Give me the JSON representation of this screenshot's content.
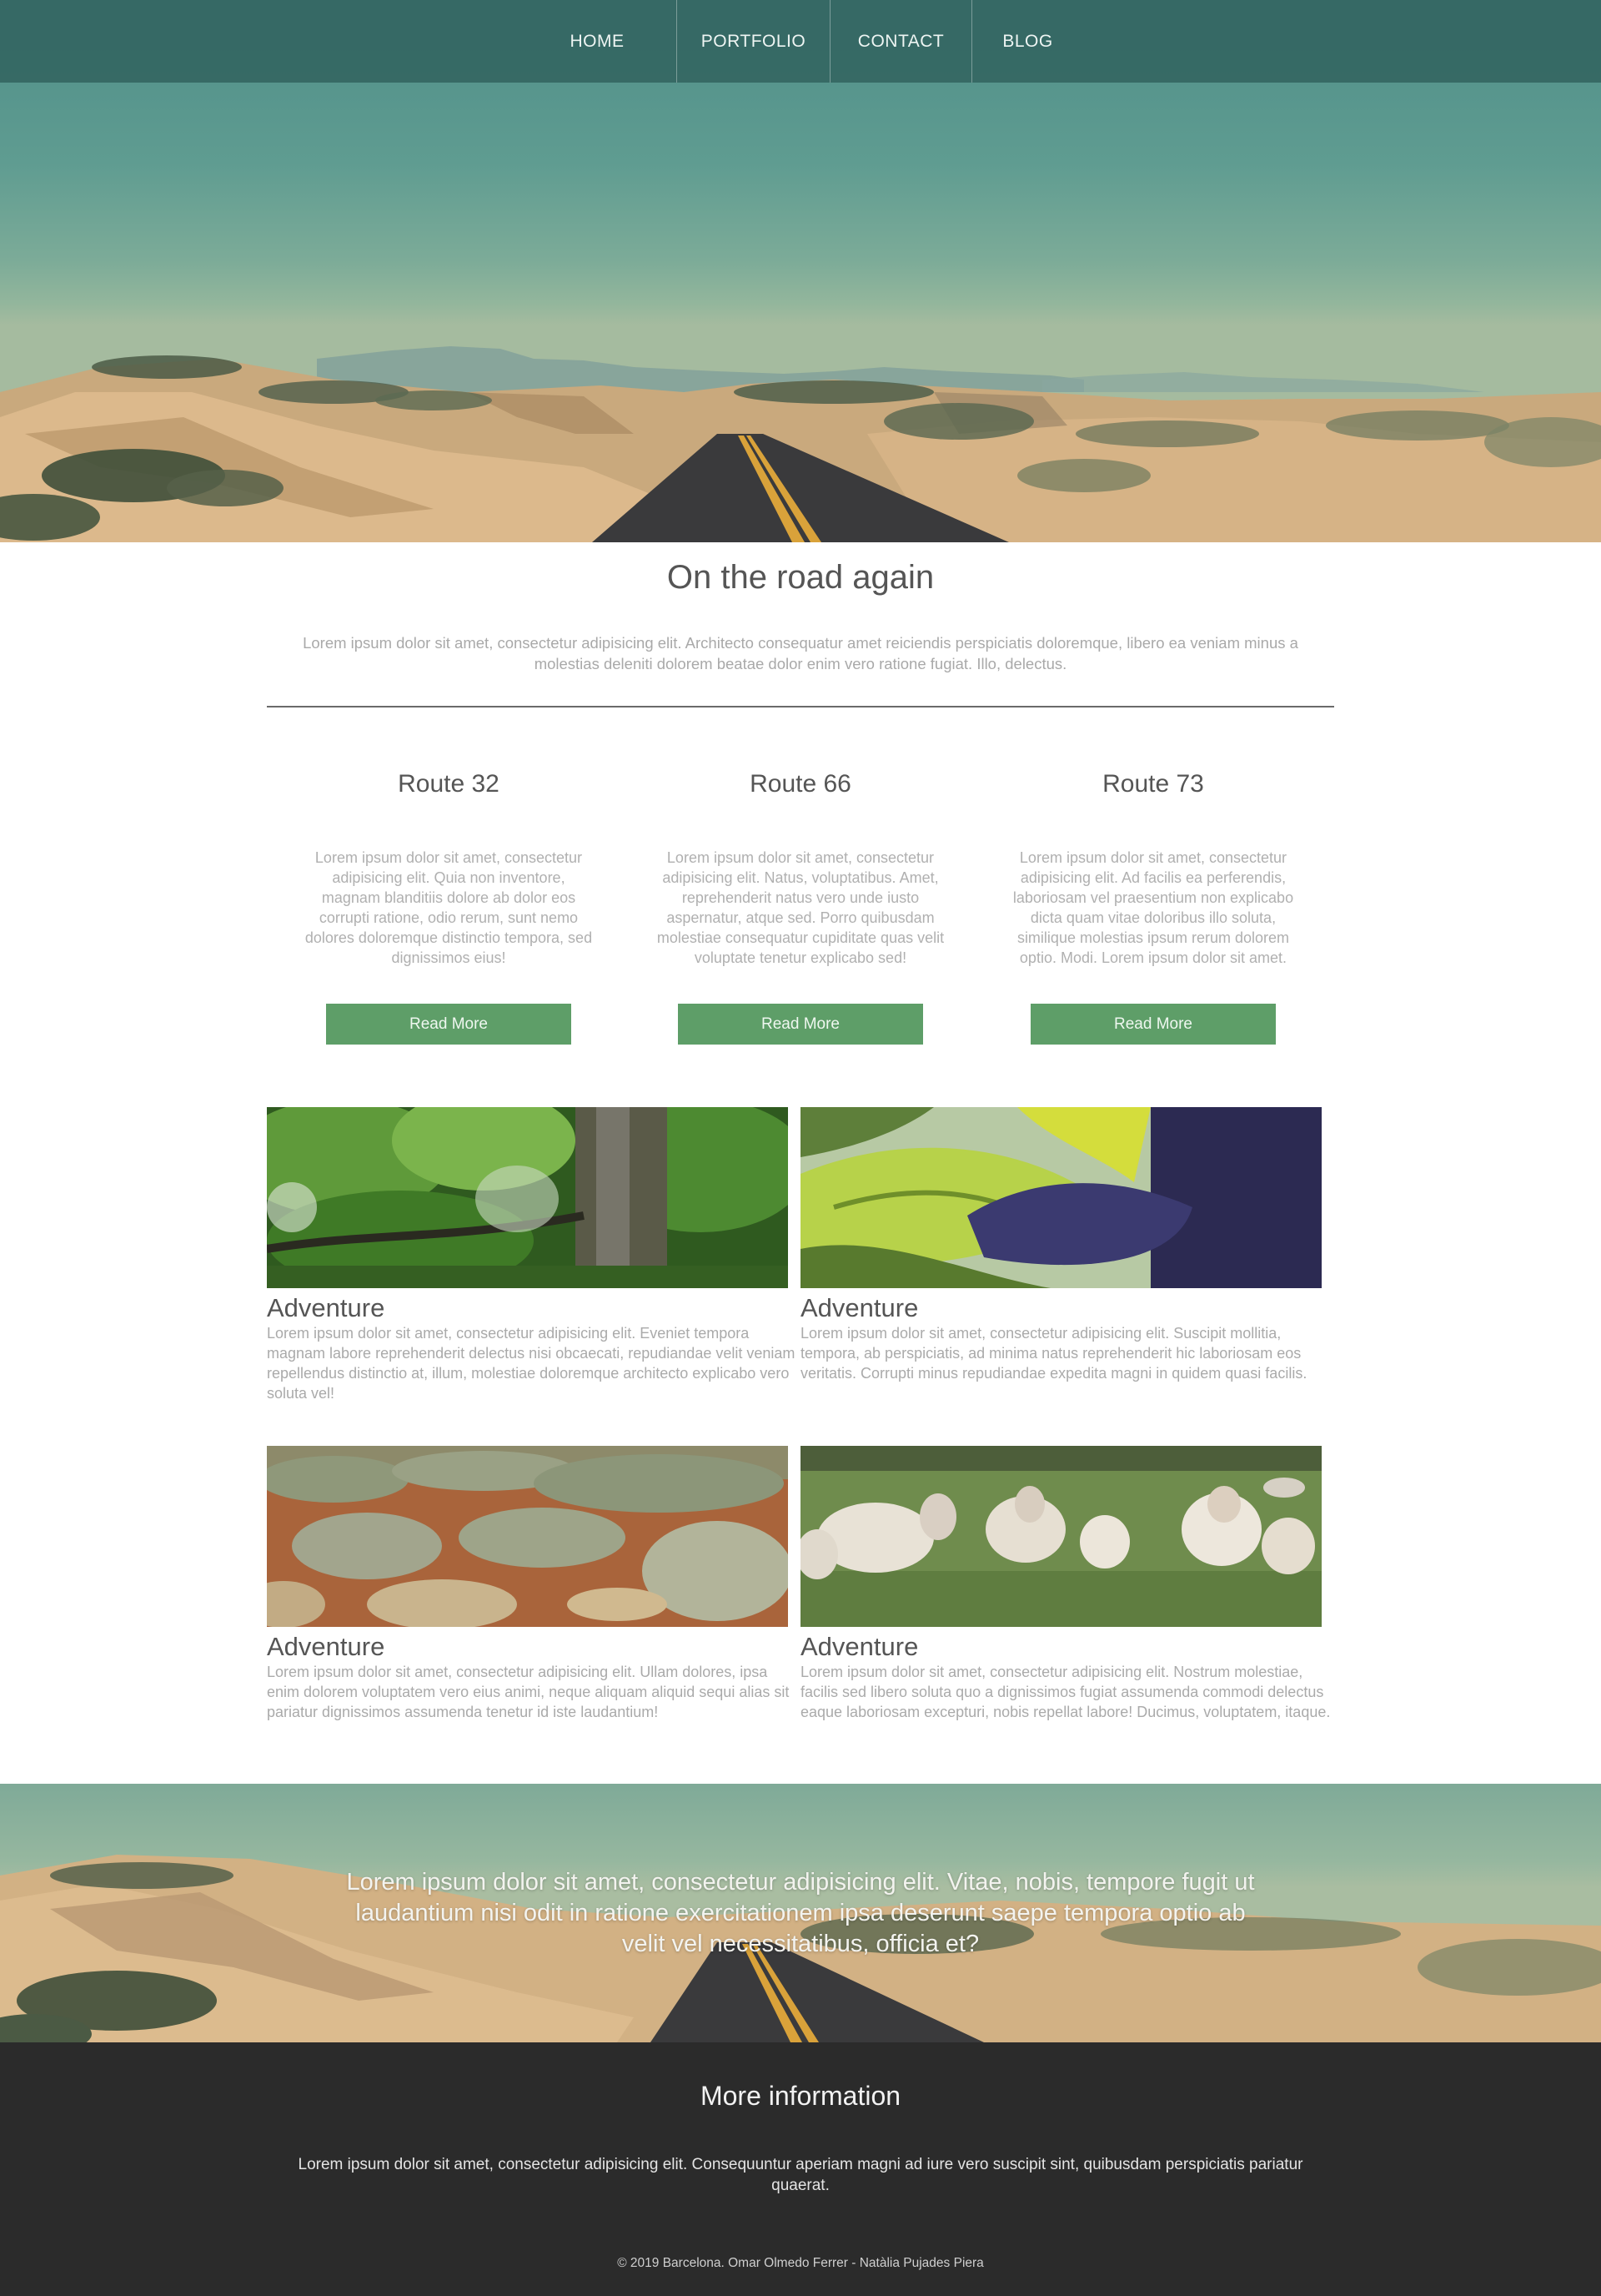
{
  "nav": {
    "items": [
      {
        "label": "HOME"
      },
      {
        "label": "PORTFOLIO"
      },
      {
        "label": "CONTACT"
      },
      {
        "label": "BLOG"
      }
    ]
  },
  "intro": {
    "title": "On the road again",
    "text": "Lorem ipsum dolor sit amet, consectetur adipisicing elit. Architecto consequatur amet reiciendis perspiciatis doloremque, libero ea veniam minus a molestias deleniti dolorem beatae dolor enim vero ratione fugiat. Illo, delectus."
  },
  "routes": [
    {
      "title": "Route 32",
      "text": "Lorem ipsum dolor sit amet, consectetur adipisicing elit. Quia non inventore, magnam blanditiis dolore ab dolor eos corrupti ratione, odio rerum, sunt nemo dolores doloremque distinctio tempora, sed dignissimos eius!",
      "button": "Read More"
    },
    {
      "title": "Route 66",
      "text": "Lorem ipsum dolor sit amet, consectetur adipisicing elit. Natus, voluptatibus. Amet, reprehenderit natus vero unde iusto aspernatur, atque sed. Porro quibusdam molestiae consequatur cupiditate quas velit voluptate tenetur explicabo sed!",
      "button": "Read More"
    },
    {
      "title": "Route 73",
      "text": "Lorem ipsum dolor sit amet, consectetur adipisicing elit. Ad facilis ea perferendis, laboriosam vel praesentium non explicabo dicta quam vitae doloribus illo soluta, similique molestias ipsum rerum dolorem optio. Modi. Lorem ipsum dolor sit amet.",
      "button": "Read More"
    }
  ],
  "gallery": [
    {
      "title": "Adventure",
      "text": "Lorem ipsum dolor sit amet, consectetur adipisicing elit. Eveniet tempora magnam labore reprehenderit delectus nisi obcaecati, repudiandae velit veniam repellendus distinctio at, illum, molestiae doloremque architecto explicabo vero soluta vel!"
    },
    {
      "title": "Adventure",
      "text": "Lorem ipsum dolor sit amet, consectetur adipisicing elit. Suscipit mollitia, tempora, ab perspiciatis, ad minima natus reprehenderit hic laboriosam eos veritatis. Corrupti minus repudiandae expedita magni in quidem quasi facilis."
    },
    {
      "title": "Adventure",
      "text": "Lorem ipsum dolor sit amet, consectetur adipisicing elit. Ullam dolores, ipsa enim dolorem voluptatem vero eius animi, neque aliquam aliquid sequi alias sit pariatur dignissimos assumenda tenetur id iste laudantium!"
    },
    {
      "title": "Adventure",
      "text": "Lorem ipsum dolor sit amet, consectetur adipisicing elit. Nostrum molestiae, facilis sed libero soluta quo a dignissimos fugiat assumenda commodi delectus eaque laboriosam excepturi, nobis repellat labore! Ducimus, voluptatem, itaque."
    }
  ],
  "banner": {
    "quote": "Lorem ipsum dolor sit amet, consectetur adipisicing elit. Vitae, nobis, tempore fugit ut laudantium nisi odit in ratione exercitationem ipsa deserunt saepe tempora optio ab velit vel necessitatibus, officia et?"
  },
  "footer": {
    "title": "More information",
    "text": "Lorem ipsum dolor sit amet, consectetur adipisicing elit. Consequuntur aperiam magni ad iure vero suscipit sint, quibusdam perspiciatis pariatur quaerat.",
    "copyright": "© 2019 Barcelona. Omar Olmedo Ferrer - Natàlia Pujades Piera"
  },
  "colors": {
    "nav_bg": "#346662",
    "button": "#5e9e68",
    "footer_bg": "#2b2b2b",
    "sand": "#d8b487",
    "road": "#3a3a3c"
  },
  "images": {
    "hero": "desert-road-photo",
    "forest": "forest-trees-photo",
    "leaf": "green-leaf-closeup-photo",
    "shrubland": "desert-shrubland-photo",
    "sheep": "sheep-in-field-photo",
    "banner": "desert-road-photo"
  }
}
